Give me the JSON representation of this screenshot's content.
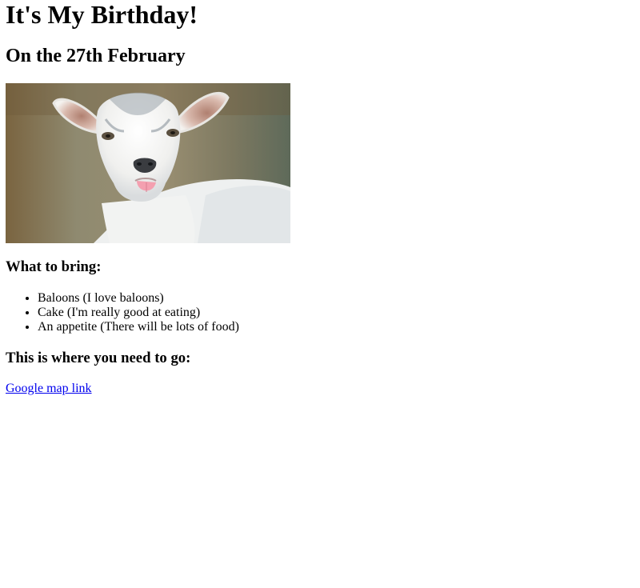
{
  "page": {
    "title": "It's My Birthday!",
    "subtitle": "On the 27th February"
  },
  "photo": {
    "subject": "goat-photo"
  },
  "bring": {
    "heading": "What to bring:",
    "items": [
      "Baloons (I love baloons)",
      "Cake (I'm really good at eating)",
      "An appetite (There will be lots of food)"
    ]
  },
  "location": {
    "heading": "This is where you need to go:",
    "link_label": "Google map link"
  },
  "colors": {
    "link": "#0000ee",
    "text": "#000000",
    "background": "#ffffff"
  }
}
